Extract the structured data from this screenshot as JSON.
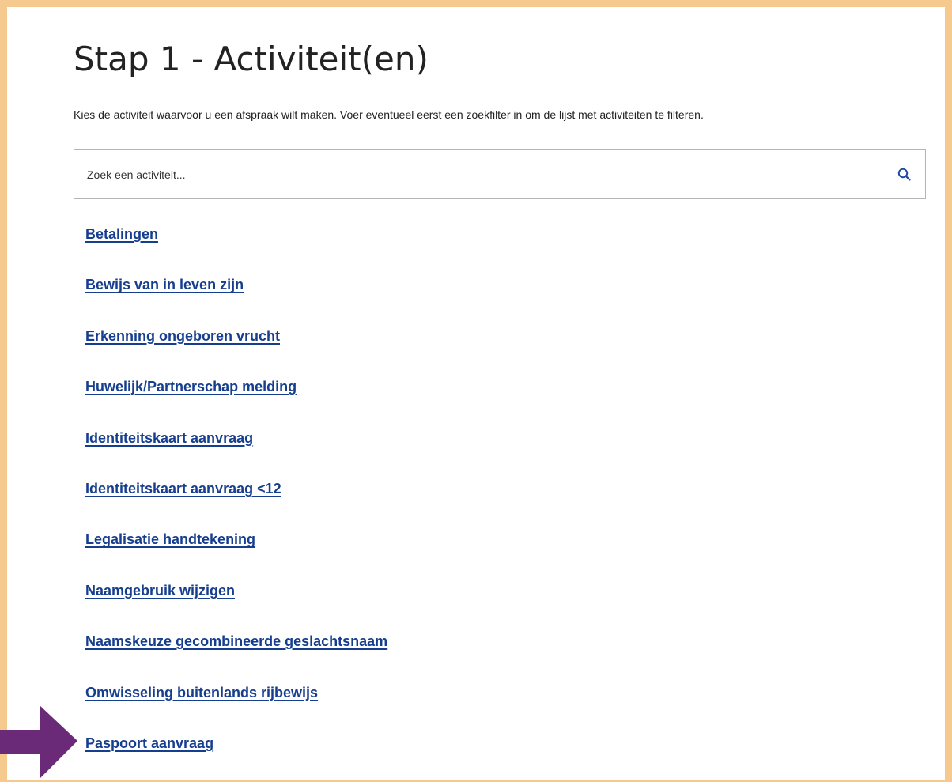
{
  "page": {
    "title": "Stap 1 - Activiteit(en)",
    "intro": "Kies de activiteit waarvoor u een afspraak wilt maken. Voer eventueel eerst een zoekfilter in om de lijst met activiteiten te filteren."
  },
  "search": {
    "placeholder": "Zoek een activiteit...",
    "value": "",
    "icon": "search-icon"
  },
  "activities": [
    {
      "label": "Betalingen"
    },
    {
      "label": "Bewijs van in leven zijn"
    },
    {
      "label": "Erkenning ongeboren vrucht"
    },
    {
      "label": "Huwelijk/Partnerschap melding"
    },
    {
      "label": "Identiteitskaart aanvraag"
    },
    {
      "label": "Identiteitskaart aanvraag <12"
    },
    {
      "label": "Legalisatie handtekening"
    },
    {
      "label": "Naamgebruik wijzigen"
    },
    {
      "label": "Naamskeuze gecombineerde geslachtsnaam"
    },
    {
      "label": "Omwisseling buitenlands rijbewijs"
    },
    {
      "label": "Paspoort aanvraag"
    }
  ],
  "highlight": {
    "target": "Paspoort aanvraag",
    "icon": "arrow-right-icon"
  },
  "colors": {
    "frame": "#f6c98f",
    "link": "#163e8f",
    "search_icon": "#1f4aa0",
    "arrow": "#6b2a78",
    "text": "#222222"
  }
}
